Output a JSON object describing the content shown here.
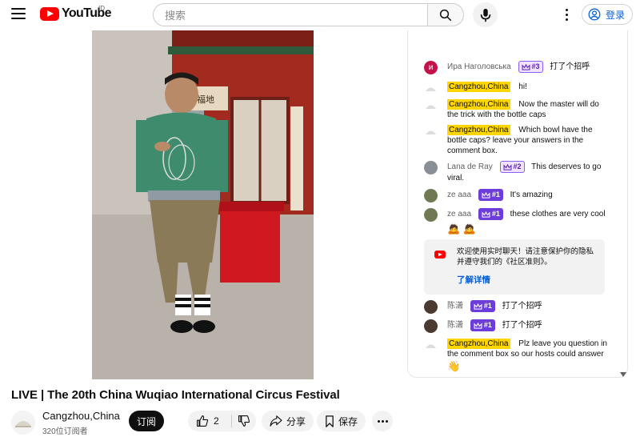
{
  "header": {
    "logo_text": "YouTube",
    "region": "ID",
    "search_placeholder": "搜索",
    "signin_label": "登录"
  },
  "video": {
    "title": "LIVE | The 20th China Wuqiao International Circus Festival",
    "sign_text": "福地"
  },
  "channel": {
    "name": "Cangzhou,China",
    "subscribers": "320位订阅者",
    "subscribe_label": "订阅"
  },
  "actions": {
    "like_count": "2",
    "share_label": "分享",
    "save_label": "保存"
  },
  "chat": {
    "messages": [
      {
        "author": "Ира Наголовська",
        "badge": "#3",
        "text": "打了个招呼"
      },
      {
        "author": "Cangzhou,China",
        "text": "hi!"
      },
      {
        "author": "Cangzhou,China",
        "text": "Now the master will do the trick with the bottle caps"
      },
      {
        "author": "Cangzhou,China",
        "text": "Which bowl have the bottle caps? leave your answers in the comment box."
      },
      {
        "author": "Lana de Ray",
        "badge": "#2",
        "text": "This deserves to go viral."
      },
      {
        "author": "ze aaa",
        "badge": "#1",
        "text": "It's amazing"
      },
      {
        "author": "ze aaa",
        "badge": "#1",
        "text": "these clothes are very cool",
        "emoji": "🙇 🙇"
      },
      {
        "author": "陈潇",
        "badge": "#1",
        "text": "打了个招呼"
      },
      {
        "author": "陈潇",
        "badge": "#1",
        "text": "打了个招呼"
      },
      {
        "author": "Cangzhou,China",
        "text": "Plz leave you question in the comment box so our hosts could answer",
        "emoji": "👋"
      }
    ],
    "notice": {
      "text": "欢迎使用实时聊天！请注意保护你的隐私并遵守我们的《社区准则》。",
      "link": "了解详情"
    }
  },
  "colors": {
    "brand_red": "#ff0000",
    "highlight_yellow": "#ffd600",
    "link_blue": "#065fd4",
    "badge_purple": "#6d3ddc"
  }
}
